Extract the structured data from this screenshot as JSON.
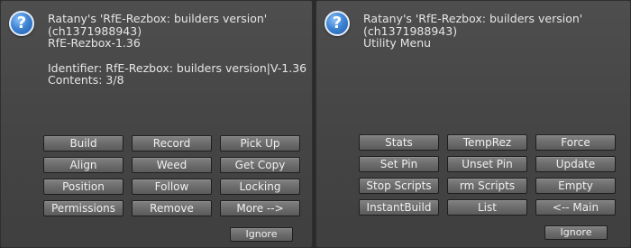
{
  "dialogs": [
    {
      "icon": "question-icon",
      "icon_glyph": "?",
      "lines": [
        "Ratany's 'RfE-Rezbox: builders version'",
        "(ch1371988943)",
        "RfE-Rezbox-1.36",
        "",
        "Identifier: RfE-Rezbox: builders version|V-1.36",
        "Contents: 3/8"
      ],
      "buttons": [
        "Build",
        "Record",
        "Pick Up",
        "Align",
        "Weed",
        "Get Copy",
        "Position",
        "Follow",
        "Locking",
        "Permissions",
        "Remove",
        "More -->"
      ],
      "ignore_label": "Ignore"
    },
    {
      "icon": "question-icon",
      "icon_glyph": "?",
      "lines": [
        "Ratany's 'RfE-Rezbox: builders version'",
        "(ch1371988943)",
        "Utility Menu"
      ],
      "buttons": [
        "Stats",
        "TempRez",
        "Force",
        "Set Pin",
        "Unset Pin",
        "Update",
        "Stop Scripts",
        "rm Scripts",
        "Empty",
        "InstantBuild",
        "List",
        "<-- Main"
      ],
      "ignore_label": "Ignore"
    }
  ],
  "colors": {
    "dialog_bg": "#4a4a4a",
    "button_bg": "#6c6c6c",
    "text": "#e6e6e6",
    "icon_blue": "#3f86d6"
  }
}
